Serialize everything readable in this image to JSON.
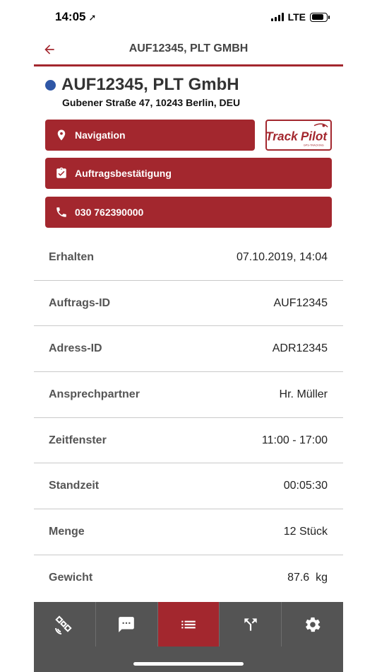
{
  "status_bar": {
    "time": "14:05",
    "location_glyph": "➚",
    "network": "LTE"
  },
  "header": {
    "title": "AUF12345, PLT GMBH"
  },
  "order": {
    "title": "AUF12345, PLT GmbH",
    "address": "Gubener Straße 47, 10243 Berlin, DEU",
    "status_color": "#2f57a6"
  },
  "actions": {
    "navigation_label": "Navigation",
    "confirmation_label": "Auftragsbestätigung",
    "phone_label": "030 762390000"
  },
  "logo": {
    "text_track": "Track",
    "text_pilot": "Pilot",
    "subtext": "GPS-TRACKING"
  },
  "details": [
    {
      "label": "Erhalten",
      "value": "07.10.2019, 14:04"
    },
    {
      "label": "Auftrags-ID",
      "value": "AUF12345"
    },
    {
      "label": "Adress-ID",
      "value": "ADR12345"
    },
    {
      "label": "Ansprechpartner",
      "value": "Hr. Müller"
    },
    {
      "label": "Zeitfenster",
      "value": "11:00 - 17:00"
    },
    {
      "label": "Standzeit",
      "value": "00:05:30"
    },
    {
      "label": "Menge",
      "value": "12 Stück"
    },
    {
      "label": "Gewicht",
      "value": "87.6  kg"
    }
  ],
  "tabs": [
    {
      "icon": "satellite-icon",
      "active": false
    },
    {
      "icon": "chat-icon",
      "active": false
    },
    {
      "icon": "list-icon",
      "active": true
    },
    {
      "icon": "route-icon",
      "active": false
    },
    {
      "icon": "gear-icon",
      "active": false
    }
  ],
  "colors": {
    "accent": "#a3272e",
    "tab_bar": "#545454",
    "status_dot": "#2f57a6"
  }
}
